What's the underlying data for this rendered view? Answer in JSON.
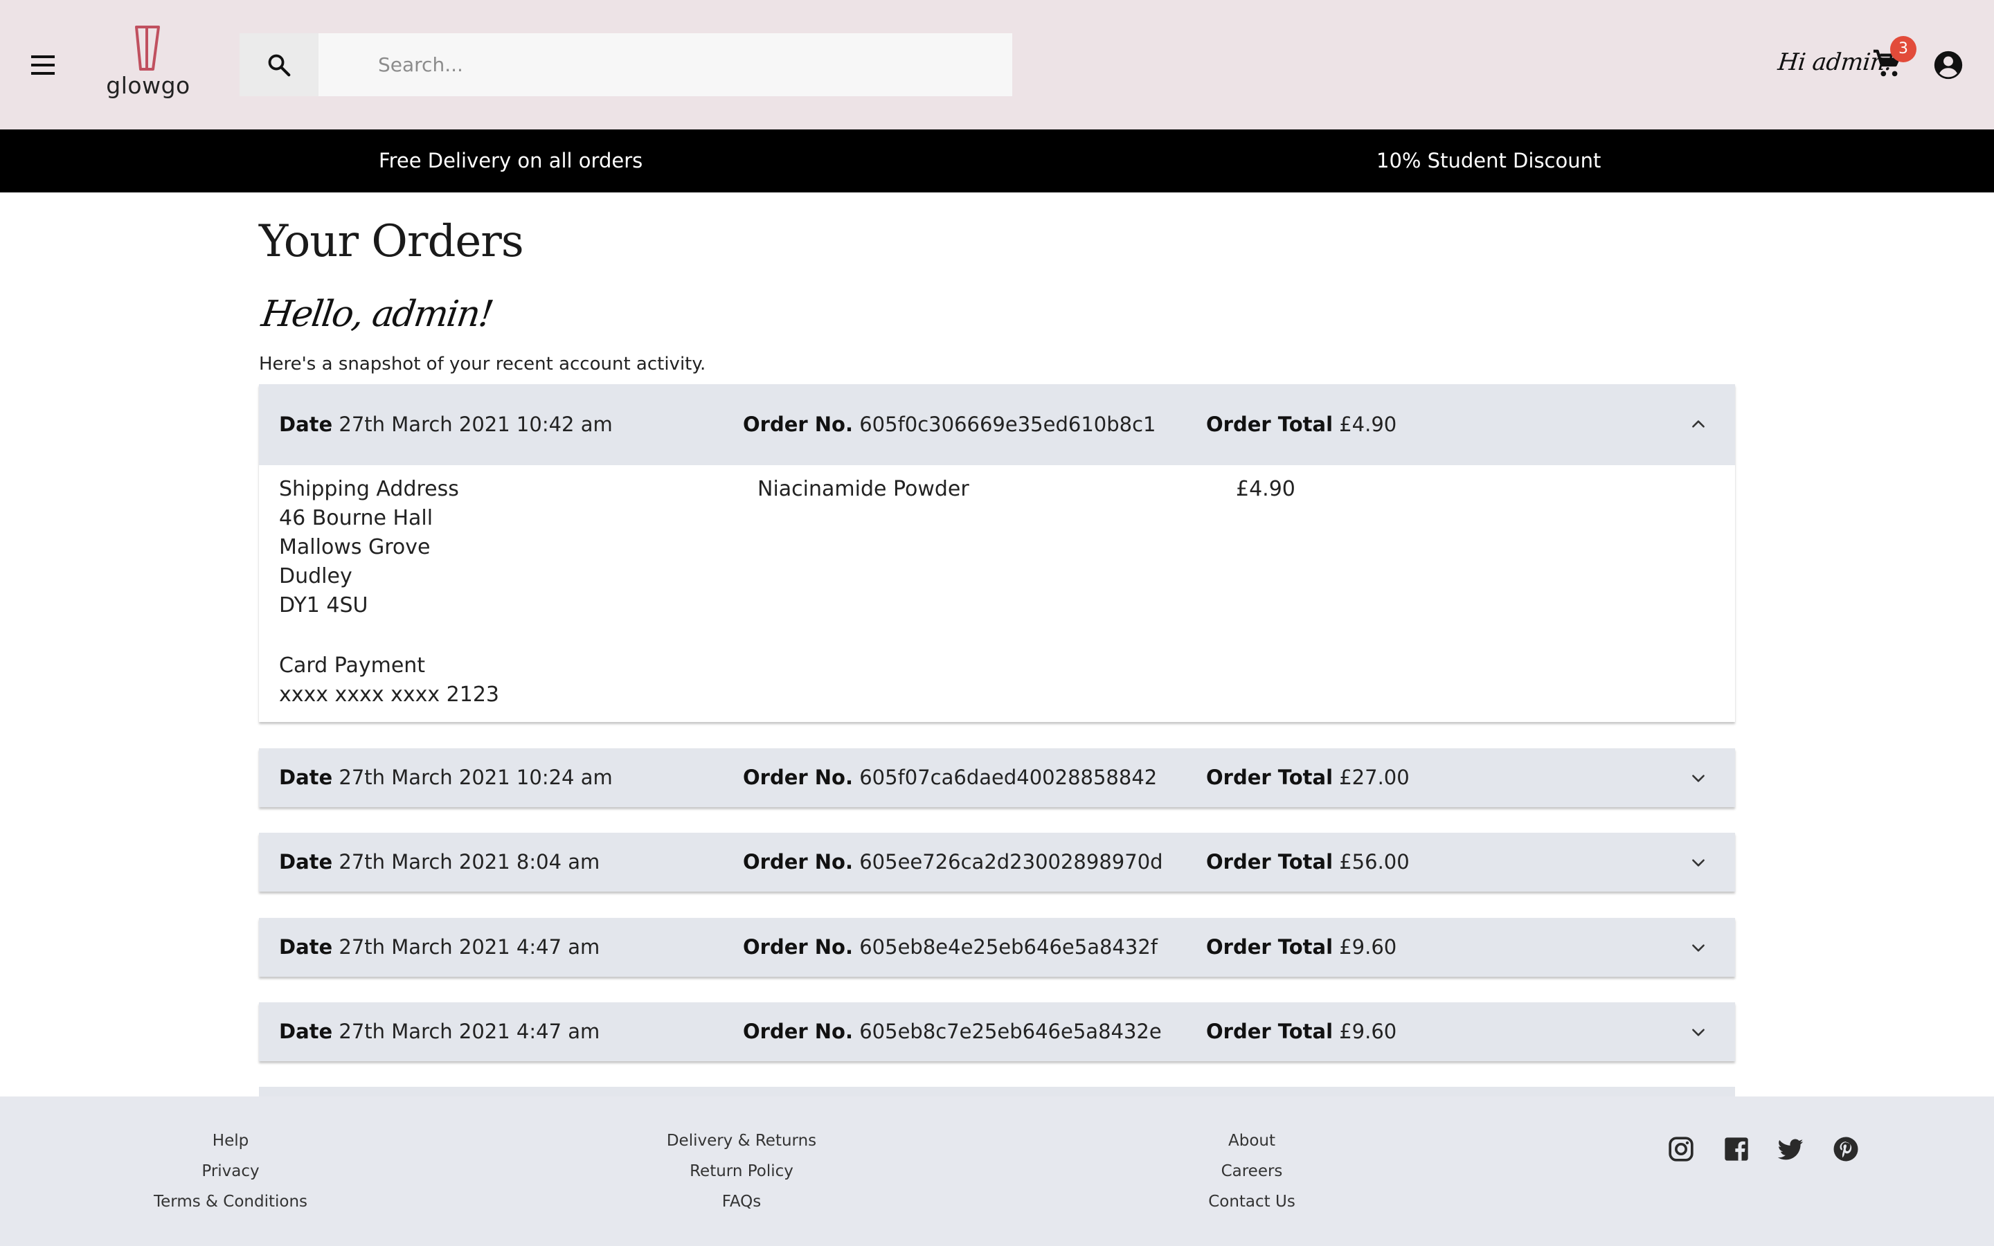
{
  "header": {
    "logo_text": "glowgo",
    "search_placeholder": "Search...",
    "greeting": "Hi admin!",
    "cart_count": "3"
  },
  "promo": {
    "left": "Free Delivery on all orders",
    "right": "10% Student Discount"
  },
  "page": {
    "title": "Your Orders",
    "hello": "Hello, admin!",
    "intro": "Here's a snapshot of your recent account activity."
  },
  "labels": {
    "date": "Date",
    "order_no": "Order No.",
    "order_total": "Order Total"
  },
  "orders": [
    {
      "date": "27th March 2021 10:42 am",
      "order_no": "605f0c306669e35ed610b8c1",
      "total": "£4.90",
      "expanded": true,
      "shipping_label": "Shipping Address",
      "address": [
        "46 Bourne Hall",
        "Mallows Grove",
        "Dudley",
        "DY1 4SU"
      ],
      "payment_label": "Card Payment",
      "card": "xxxx xxxx xxxx 2123",
      "items": [
        {
          "name": "Niacinamide Powder",
          "price": "£4.90"
        }
      ]
    },
    {
      "date": "27th March 2021 10:24 am",
      "order_no": "605f07ca6daed40028858842",
      "total": "£27.00",
      "expanded": false
    },
    {
      "date": "27th March 2021 8:04 am",
      "order_no": "605ee726ca2d23002898970d",
      "total": "£56.00",
      "expanded": false
    },
    {
      "date": "27th March 2021 4:47 am",
      "order_no": "605eb8e4e25eb646e5a8432f",
      "total": "£9.60",
      "expanded": false
    },
    {
      "date": "27th March 2021 4:47 am",
      "order_no": "605eb8c7e25eb646e5a8432e",
      "total": "£9.60",
      "expanded": false
    }
  ],
  "footer": {
    "col1": [
      "Help",
      "Privacy",
      "Terms & Conditions"
    ],
    "col2": [
      "Delivery & Returns",
      "Return Policy",
      "FAQs"
    ],
    "col3": [
      "About",
      "Careers",
      "Contact Us"
    ],
    "social": [
      "instagram-icon",
      "facebook-icon",
      "twitter-icon",
      "pinterest-icon"
    ]
  },
  "colors": {
    "header_bg": "#ede3e6",
    "promo_bg": "#000000",
    "order_header_bg": "#e3e6ec",
    "footer_bg": "#e6e8ee",
    "badge": "#e24b3a",
    "logo_accent": "#c0505f"
  }
}
